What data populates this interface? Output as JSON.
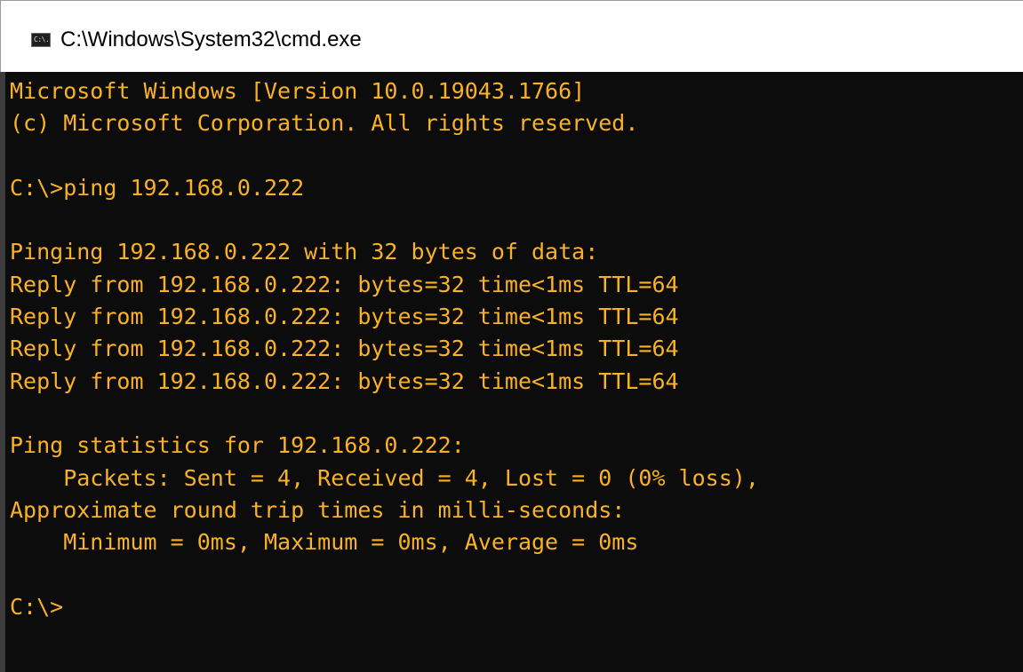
{
  "window": {
    "title": "C:\\Windows\\System32\\cmd.exe",
    "icon": "cmd-console-icon",
    "icon_glyph": "C:\\."
  },
  "console": {
    "text_color": "#f9b126",
    "background": "#0c0c0c",
    "lines": [
      "Microsoft Windows [Version 10.0.19043.1766]",
      "(c) Microsoft Corporation. All rights reserved.",
      "",
      "C:\\>ping 192.168.0.222",
      "",
      "Pinging 192.168.0.222 with 32 bytes of data:",
      "Reply from 192.168.0.222: bytes=32 time<1ms TTL=64",
      "Reply from 192.168.0.222: bytes=32 time<1ms TTL=64",
      "Reply from 192.168.0.222: bytes=32 time<1ms TTL=64",
      "Reply from 192.168.0.222: bytes=32 time<1ms TTL=64",
      "",
      "Ping statistics for 192.168.0.222:",
      "    Packets: Sent = 4, Received = 4, Lost = 0 (0% loss),",
      "Approximate round trip times in milli-seconds:",
      "    Minimum = 0ms, Maximum = 0ms, Average = 0ms",
      "",
      "C:\\>"
    ]
  }
}
